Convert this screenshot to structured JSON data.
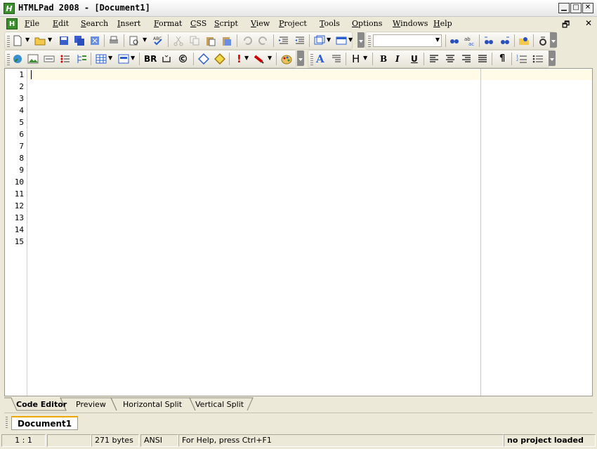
{
  "window": {
    "title": "HTMLPad 2008 - [Document1]",
    "app_icon_glyph": "H"
  },
  "menu": [
    {
      "label": "File"
    },
    {
      "label": "Edit"
    },
    {
      "label": "Search"
    },
    {
      "label": "Insert"
    },
    {
      "label": "Format"
    },
    {
      "label": "CSS"
    },
    {
      "label": "Script"
    },
    {
      "label": "View"
    },
    {
      "label": "Project"
    },
    {
      "label": "Tools"
    },
    {
      "label": "Options"
    },
    {
      "label": "Windows"
    },
    {
      "label": "Help"
    }
  ],
  "toolbar2": {
    "br_label": "BR",
    "copyright_glyph": "©",
    "bold": "B",
    "italic": "I",
    "underline": "U",
    "heading": "H",
    "font_glyph": "A",
    "para": "¶"
  },
  "editor": {
    "line_numbers": [
      "1",
      "2",
      "3",
      "4",
      "5",
      "6",
      "7",
      "8",
      "9",
      "10",
      "11",
      "12",
      "13",
      "14",
      "15"
    ]
  },
  "view_tabs": [
    "Code Editor",
    "Preview",
    "Horizontal Split",
    "Vertical Split"
  ],
  "doc_tab": "Document1",
  "status": {
    "position": "1 : 1",
    "size": "271 bytes",
    "encoding": "ANSI",
    "help": "For Help, press Ctrl+F1",
    "project": "no project loaded"
  },
  "colors": {
    "accent": "#f0a800",
    "current_line": "#fffbe6",
    "app_green": "#3a8f2c"
  }
}
